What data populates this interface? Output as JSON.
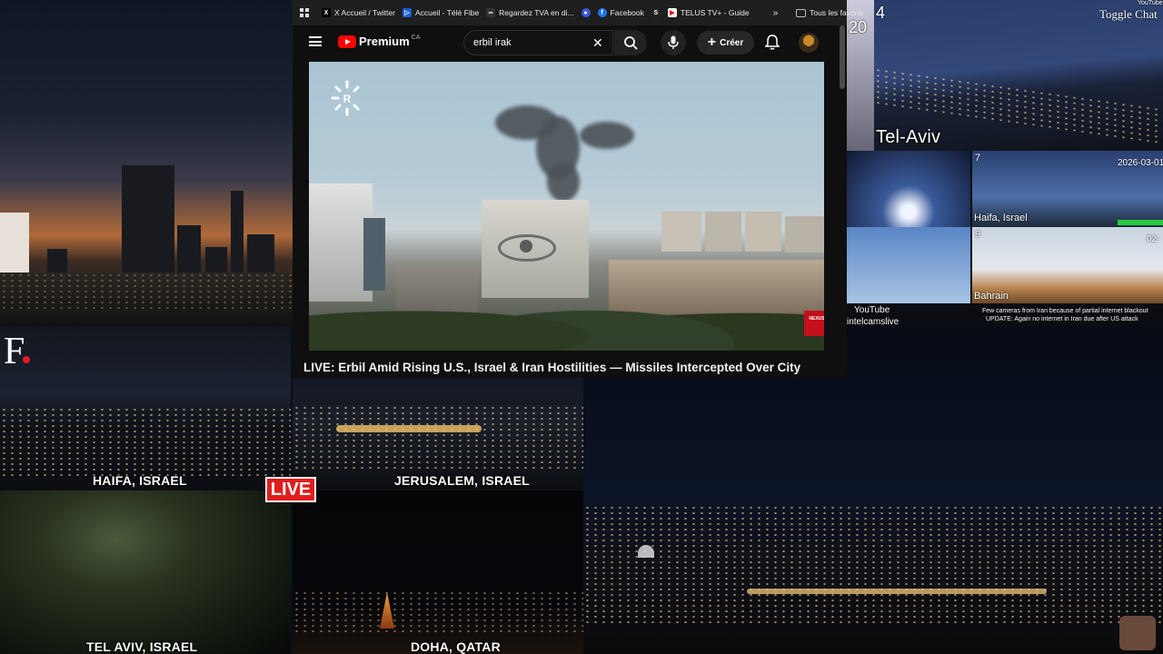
{
  "browser": {
    "bookmarks": [
      {
        "label": "X Accueil / Twitter",
        "icon": "x-logo-icon"
      },
      {
        "label": "Accueil - Télé Fibe",
        "icon": "bell-fibe-icon"
      },
      {
        "label": "Regardez TVA en di...",
        "icon": "tva-icon"
      },
      {
        "label": "",
        "icon": "shield-icon"
      },
      {
        "label": "Facebook",
        "icon": "facebook-icon"
      },
      {
        "label": "",
        "icon": "s-logo-icon"
      },
      {
        "label": "TELUS TV+ - Guide",
        "icon": "youtube-play-icon"
      }
    ],
    "more_bookmarks": "»",
    "all_bookmarks": "Tous les favoris"
  },
  "youtube": {
    "brand": "Premium",
    "region": "CA",
    "search": {
      "value": "erbil irak"
    },
    "create_label": "Créer"
  },
  "video": {
    "title": "LIVE: Erbil Amid Rising U.S., Israel & Iran Hostilities — Missiles Intercepted Over City",
    "channel_logo_text": "NEXUS"
  },
  "feeds": {
    "haifa": "HAIFA, ISRAEL",
    "jerusalem": "JERUSALEM, ISRAEL",
    "telaviv": "TEL AVIV, ISRAEL",
    "doha": "DOHA, QATAR",
    "live_badge": "LIVE",
    "f_logo": "F",
    "grid": {
      "cell_number_a": "20",
      "cell_number_b": "4",
      "toggle_chat": "Toggle Chat",
      "youtube_tag": "YouTube",
      "telaviv": "Tel-Aviv",
      "cell_7": "7",
      "date": "2026-03-01",
      "haifa": "Haifa, Israel",
      "cell_9": "9",
      "bahrain": "Bahrain",
      "date_b": "02-",
      "youtube_channel_1": "YouTube",
      "youtube_channel_2": "intelcamslive",
      "notice_1": "Few cameras from Iran because of partial internet blackout",
      "notice_2": "UPDATE: Again no internet in Iran due after US attack"
    }
  },
  "colors": {
    "live_red": "#e11d1d",
    "youtube_red": "#ff0000",
    "yt_dark": "#0f0f0f"
  }
}
